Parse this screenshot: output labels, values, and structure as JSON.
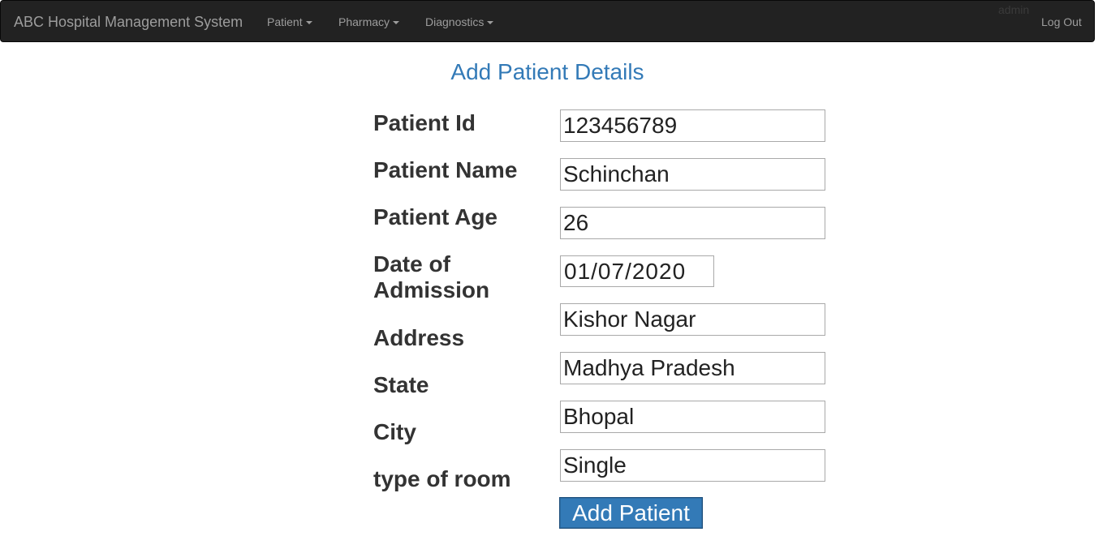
{
  "navbar": {
    "brand": "ABC Hospital Management System",
    "menus": [
      {
        "label": "Patient"
      },
      {
        "label": "Pharmacy"
      },
      {
        "label": "Diagnostics"
      }
    ],
    "user": "admin",
    "logout_label": "Log Out"
  },
  "form": {
    "title": "Add Patient Details",
    "fields": [
      {
        "label": "Patient Id",
        "value": "123456789"
      },
      {
        "label": "Patient Name",
        "value": "Schinchan"
      },
      {
        "label": "Patient Age",
        "value": "26"
      },
      {
        "label": "Date of Admission",
        "value": "01/07/2020"
      },
      {
        "label": "Address",
        "value": "Kishor Nagar"
      },
      {
        "label": "State",
        "value": "Madhya Pradesh"
      },
      {
        "label": "City",
        "value": "Bhopal"
      },
      {
        "label": "type of room",
        "value": "Single"
      }
    ],
    "submit_label": "Add Patient"
  },
  "colors": {
    "navbar_bg": "#222222",
    "accent": "#337ab7",
    "nav_text": "#9d9d9d"
  }
}
